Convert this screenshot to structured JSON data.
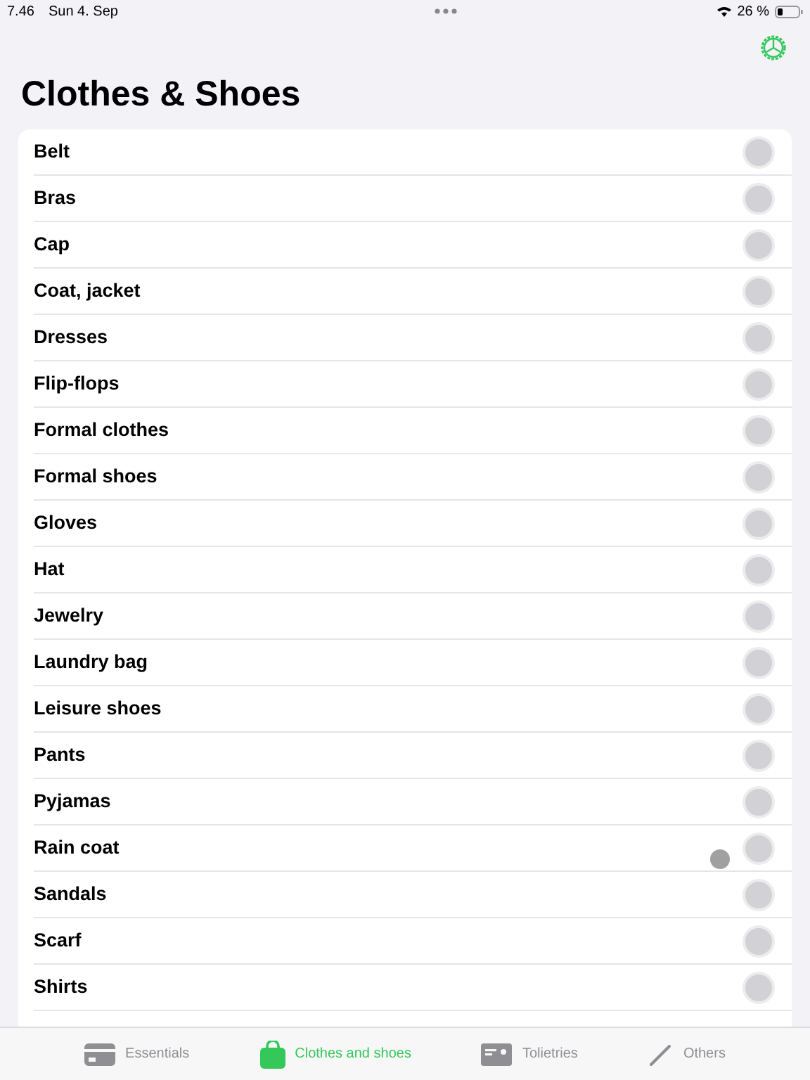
{
  "status_bar": {
    "time": "7.46",
    "date": "Sun 4. Sep",
    "battery": "26 %"
  },
  "title": "Clothes & Shoes",
  "items": [
    {
      "label": "Belt",
      "checked": false
    },
    {
      "label": "Bras",
      "checked": false
    },
    {
      "label": "Cap",
      "checked": false
    },
    {
      "label": "Coat, jacket",
      "checked": false
    },
    {
      "label": "Dresses",
      "checked": false
    },
    {
      "label": "Flip-flops",
      "checked": false
    },
    {
      "label": "Formal clothes",
      "checked": false
    },
    {
      "label": "Formal shoes",
      "checked": false
    },
    {
      "label": "Gloves",
      "checked": false
    },
    {
      "label": "Hat",
      "checked": false
    },
    {
      "label": "Jewelry",
      "checked": false
    },
    {
      "label": "Laundry bag",
      "checked": false
    },
    {
      "label": "Leisure shoes",
      "checked": false
    },
    {
      "label": "Pants",
      "checked": false
    },
    {
      "label": "Pyjamas",
      "checked": false
    },
    {
      "label": "Rain coat",
      "checked": false
    },
    {
      "label": "Sandals",
      "checked": false
    },
    {
      "label": "Scarf",
      "checked": false
    },
    {
      "label": "Shirts",
      "checked": false
    }
  ],
  "tabs": [
    {
      "label": "Essentials",
      "kind": "card",
      "selected": false
    },
    {
      "label": "Clothes and shoes",
      "kind": "bag",
      "selected": true
    },
    {
      "label": "Tolietries",
      "kind": "id",
      "selected": false
    },
    {
      "label": "Others",
      "kind": "pencil",
      "selected": false
    }
  ]
}
